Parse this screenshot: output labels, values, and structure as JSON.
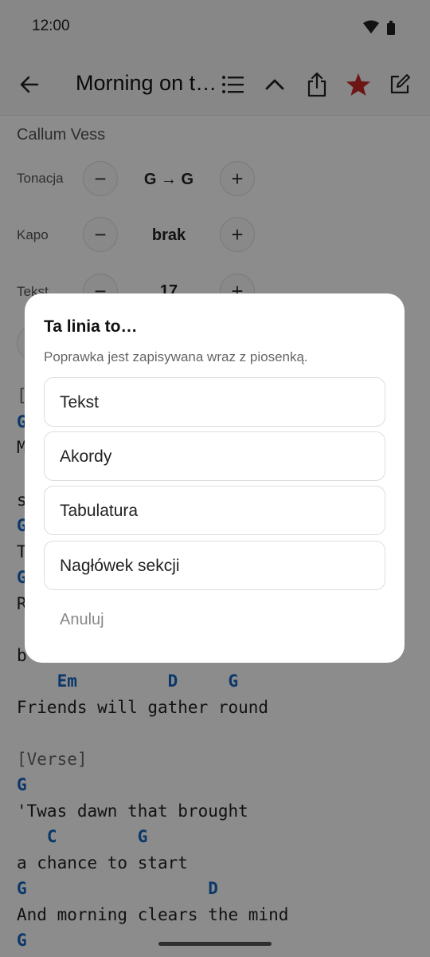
{
  "status_bar": {
    "time": "12:00"
  },
  "toolbar": {
    "title": "Morning on t…",
    "icons": [
      "back-arrow",
      "list",
      "chevron-up",
      "share",
      "star",
      "edit"
    ],
    "star_color": "#c62828"
  },
  "song": {
    "artist": "Callum Vess",
    "controls": {
      "key_label": "Tonacja",
      "key_value": "G → G",
      "capo_label": "Kapo",
      "capo_value": "brak",
      "text_label": "Tekst",
      "text_value": "17",
      "minus": "−",
      "plus": "+"
    },
    "partial_lines": [
      "[",
      "G",
      "M",
      "s",
      "G",
      "T",
      "G",
      "R",
      "b"
    ],
    "lines": [
      {
        "text": "    Em         D     G",
        "kind": "chord"
      },
      {
        "text": "Friends will gather round",
        "kind": "lyric"
      },
      {
        "text": "[Verse]",
        "kind": "section"
      },
      {
        "text": "G",
        "kind": "chord"
      },
      {
        "text": "'Twas dawn that brought",
        "kind": "lyric"
      },
      {
        "text": "   C        G",
        "kind": "chord"
      },
      {
        "text": "a chance to start",
        "kind": "lyric"
      },
      {
        "text": "G                  D",
        "kind": "chord"
      },
      {
        "text": "And morning clears the mind",
        "kind": "lyric"
      },
      {
        "text": "G",
        "kind": "chord"
      }
    ],
    "chord_color": "#1565c0"
  },
  "dialog": {
    "title": "Ta linia to…",
    "subtitle": "Poprawka jest zapisywana wraz z piosenką.",
    "options": [
      "Tekst",
      "Akordy",
      "Tabulatura",
      "Nagłówek sekcji"
    ],
    "cancel": "Anuluj"
  }
}
